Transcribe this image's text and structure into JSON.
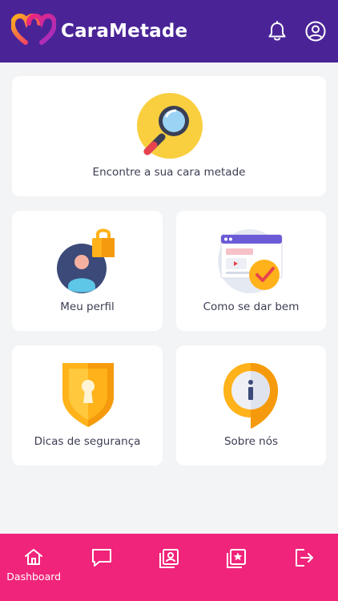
{
  "header": {
    "brand_name": "CaraMetade",
    "icons": {
      "logo": "hearts-logo-icon",
      "notifications": "bell-icon",
      "account": "user-circle-icon"
    }
  },
  "cards": {
    "find": {
      "label": "Encontre a sua cara metade",
      "icon": "magnifier-icon"
    },
    "profile": {
      "label": "Meu perfil",
      "icon": "user-lock-icon"
    },
    "tips": {
      "label": "Como se dar bem",
      "icon": "browser-check-icon"
    },
    "safety": {
      "label": "Dicas de segurança",
      "icon": "shield-keyhole-icon"
    },
    "about": {
      "label": "Sobre nós",
      "icon": "info-bubble-icon"
    }
  },
  "bottom_nav": {
    "items": [
      {
        "label": "Dashboard",
        "icon": "home-icon",
        "active": true
      },
      {
        "label": "",
        "icon": "chat-icon"
      },
      {
        "label": "",
        "icon": "contacts-icon"
      },
      {
        "label": "",
        "icon": "starred-gallery-icon"
      },
      {
        "label": "",
        "icon": "logout-icon"
      }
    ]
  },
  "colors": {
    "header_bg": "#4a2497",
    "page_bg": "#f3f4f6",
    "nav_bg": "#f0247a",
    "card_text": "#3b3d52"
  }
}
